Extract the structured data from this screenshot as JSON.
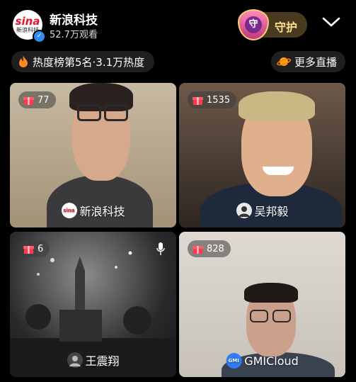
{
  "header": {
    "channel_name": "新浪科技",
    "viewers": "52.7万观看",
    "logo_text": "sina",
    "logo_sub": "新浪科技",
    "guard_label": "守护",
    "guard_badge": "守"
  },
  "status": {
    "hot_text": "热度榜第5名·3.1万热度",
    "more_text": "更多直播"
  },
  "tiles": [
    {
      "gift_count": "77",
      "name": "新浪科技"
    },
    {
      "gift_count": "1535",
      "name": "吴邦毅"
    },
    {
      "gift_count": "6",
      "name": "王震翔"
    },
    {
      "gift_count": "828",
      "name": "GMICloud"
    }
  ],
  "colors": {
    "gift": "#ff3b4f",
    "guard_text": "#ffe08a",
    "verify": "#2f8cf0"
  }
}
